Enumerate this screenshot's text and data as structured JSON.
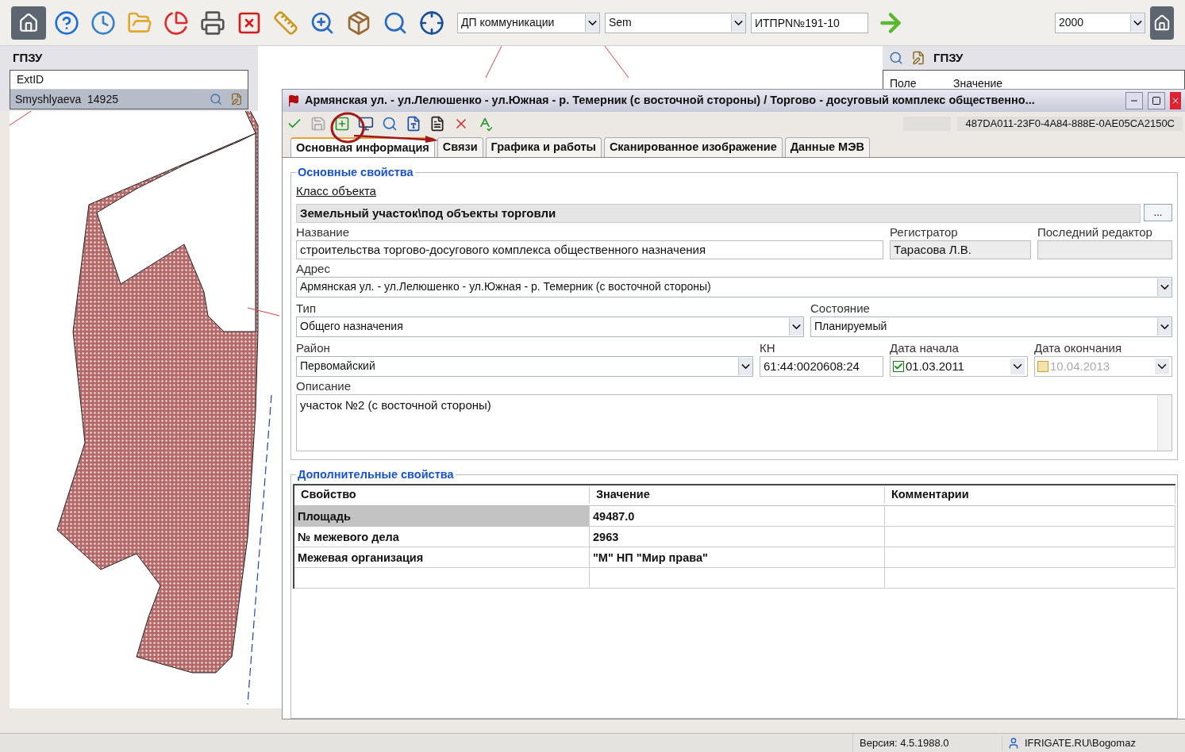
{
  "toolbar": {
    "layer_select": {
      "value": "ДП коммуникации"
    },
    "field_select": {
      "value": "Sem"
    },
    "search_field": {
      "value": "ИТПРN№191-10"
    },
    "scale_select": {
      "value": "2000"
    }
  },
  "left_panel": {
    "title": "ГПЗУ",
    "columns": [
      "ExtID"
    ],
    "rows": [
      {
        "text": "Smyshlyaeva  14925",
        "selected": true
      }
    ]
  },
  "right_panel": {
    "title": "ГПЗУ",
    "columns": [
      "Поле",
      "Значение"
    ]
  },
  "dialog": {
    "title": "Армянская ул. - ул.Лелюшенко - ул.Южная - р. Темерник (с восточной стороны) / Торгово - досуговый комплекс общественно...",
    "object_id": "487DA011-23F0-4A84-888E-0AE05CA2150C",
    "tabs": [
      {
        "label": "Основная информация",
        "selected": true
      },
      {
        "label": "Связи",
        "selected": false
      },
      {
        "label": "Графика и работы",
        "selected": false
      },
      {
        "label": "Сканированное изображение",
        "selected": false
      },
      {
        "label": "Данные МЭВ",
        "selected": false
      }
    ],
    "main": {
      "title": "Основные свойства",
      "class_link": "Класс объекта",
      "class_value": "Земельный участок\\под объекты торговли",
      "browse_button": "...",
      "name": {
        "label": "Название",
        "value": "строительства торгово-досугового комплекса общественного назначения"
      },
      "registrar": {
        "label": "Регистратор",
        "value": "Тарасова Л.В."
      },
      "last_editor": {
        "label": "Последний редактор"
      },
      "address": {
        "label": "Адрес",
        "value": "Армянская ул. - ул.Лелюшенко - ул.Южная - р. Темерник (с восточной стороны)"
      },
      "type": {
        "label": "Тип",
        "value": "Общего назначения"
      },
      "state": {
        "label": "Состояние",
        "value": "Планируемый"
      },
      "district": {
        "label": "Район",
        "value": "Первомайский"
      },
      "cadastral": {
        "label": "КН",
        "value": "61:44:0020608:24"
      },
      "start_date": {
        "label": "Дата начала",
        "value": "01.03.2011",
        "checked": true
      },
      "end_date": {
        "label": "Дата окончания",
        "value": "10.04.2013",
        "checked": false
      },
      "description": {
        "label": "Описание",
        "value": "участок №2 (с восточной стороны)"
      }
    },
    "extra": {
      "title": "Дополнительные свойства",
      "columns": [
        "Свойство",
        "Значение",
        "Комментарии"
      ],
      "rows": [
        {
          "property": "Площадь",
          "value": "49487.0",
          "selected": true
        },
        {
          "property": "№ межевого дела",
          "value": "2963",
          "selected": false
        },
        {
          "property": "Межевая организация",
          "value": "\"М\" НП \"Мир права\"",
          "selected": false
        }
      ]
    }
  },
  "status_bar": {
    "version": "Версия: 4.5.1988.0",
    "user": "IFRIGATE.RU\\Bogomaz"
  }
}
